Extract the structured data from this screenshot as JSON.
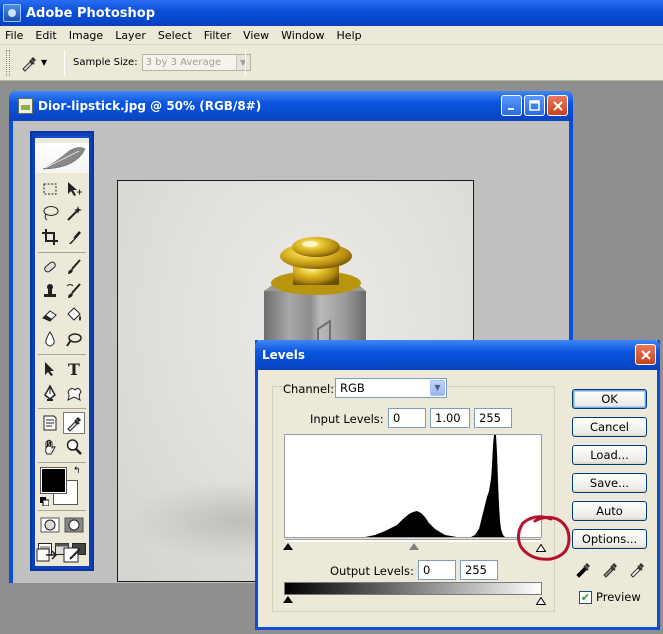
{
  "app": {
    "title": "Adobe Photoshop"
  },
  "menubar": {
    "items": [
      "File",
      "Edit",
      "Image",
      "Layer",
      "Select",
      "Filter",
      "View",
      "Window",
      "Help"
    ]
  },
  "optionsbar": {
    "sample_size_label": "Sample Size:",
    "sample_size_value": "3 by 3 Average"
  },
  "document": {
    "title": "Dior-lipstick.jpg @ 50% (RGB/8#)"
  },
  "levels": {
    "title": "Levels",
    "channel_label": "Channel:",
    "channel_value": "RGB",
    "input_levels_label": "Input Levels:",
    "input_black": "0",
    "input_gamma": "1.00",
    "input_white": "255",
    "output_levels_label": "Output Levels:",
    "output_black": "0",
    "output_white": "255",
    "buttons": {
      "ok": "OK",
      "cancel": "Cancel",
      "load": "Load...",
      "save": "Save...",
      "auto": "Auto",
      "options": "Options..."
    },
    "preview_label": "Preview",
    "preview_checked": true
  },
  "toolbox": {
    "foreground_color": "#000000",
    "background_color": "#ffffff"
  },
  "colors": {
    "xp_blue": "#0a4fd8",
    "dialog_bg": "#ece9d8",
    "annotation_red": "#b3132b"
  }
}
